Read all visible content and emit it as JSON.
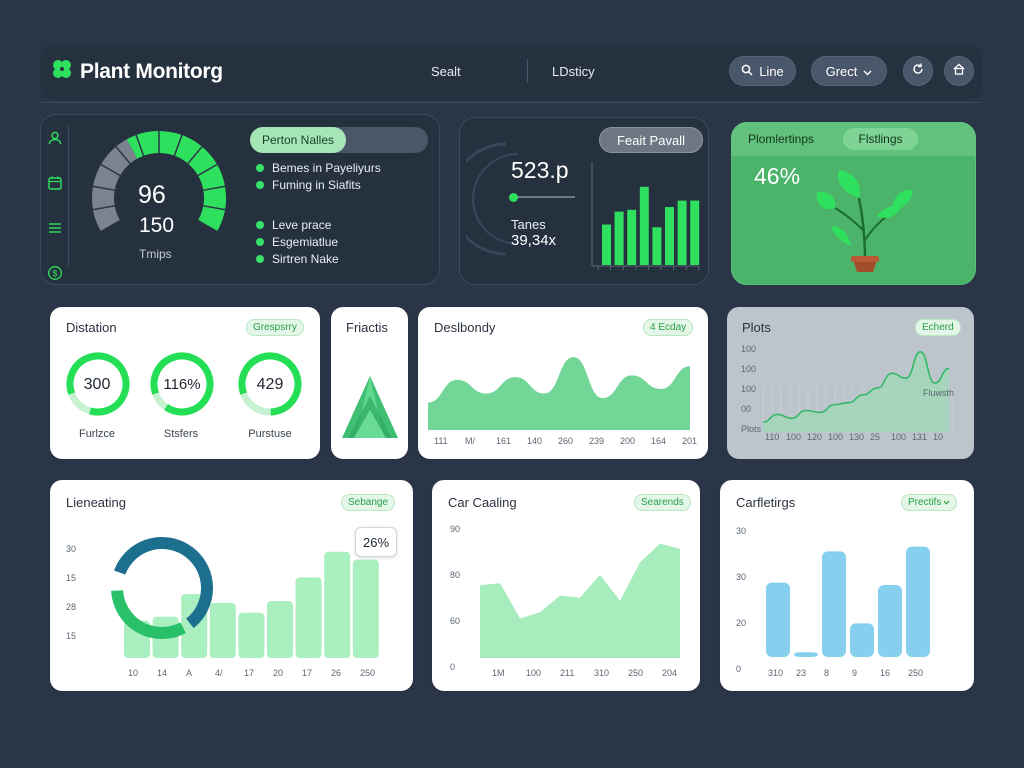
{
  "app": {
    "title": "Plant Monitorg"
  },
  "nav": {
    "link1": "Sealt",
    "link2": "LDsticy"
  },
  "controls": {
    "search_label": "Line",
    "select_label": "Grect"
  },
  "icons": {
    "brand": "clover-icon",
    "btn1": "refresh-icon",
    "btn2": "home-icon",
    "side": [
      "user-icon",
      "calendar-icon",
      "list-icon",
      "dollar-icon"
    ]
  },
  "colors": {
    "accent": "#2ee05e",
    "panel": "#26313f",
    "bg": "#2a3547",
    "mint": "#9ee9b0",
    "blue": "#86d0ef"
  },
  "gauge": {
    "value": "96",
    "sub": "150",
    "caption": "Tmips",
    "fill_fraction": 0.62
  },
  "legend_panel": {
    "header": "Perton Nalles",
    "items": [
      "Bemes in Payeliyurs",
      "Fuming in Siafits",
      "Leve prace",
      "Esgemiatlue",
      "Sirtren Nake"
    ]
  },
  "stat_panel": {
    "value": "523.p",
    "label": "Tanes",
    "value2": "39,34x",
    "badge": "Feait Pavall",
    "bar_values": [
      0.44,
      0.58,
      0.6,
      0.85,
      0.41,
      0.63,
      0.7,
      0.7
    ]
  },
  "plant_panel": {
    "title": "Plomlertinps",
    "tab": "Flstlings",
    "percent": "46%"
  },
  "distribution": {
    "title": "Distation",
    "tag": "Grespsrry",
    "rings": [
      {
        "value": "300",
        "label": "Furlzce",
        "fraction": 0.85
      },
      {
        "value": "116%",
        "label": "Stsfers",
        "fraction": 0.9
      },
      {
        "value": "429",
        "label": "Purstuse",
        "fraction": 0.8
      }
    ]
  },
  "fractis": {
    "title": "Friactis"
  },
  "deslbondy": {
    "title": "Deslbondy",
    "tag": "4 Ecday",
    "x_labels": [
      "111",
      "M/",
      "161",
      "140",
      "260",
      "239",
      "200",
      "164",
      "201"
    ]
  },
  "plots": {
    "title": "Plots",
    "tag": "Echerd",
    "annotation": "Fluwsth",
    "y_labels": [
      "100",
      "100",
      "100",
      "00",
      "Plots"
    ],
    "x_labels": [
      "110",
      "100",
      "120",
      "100",
      "130",
      "25",
      "100",
      "131",
      "10"
    ]
  },
  "lienearing": {
    "title": "Lieneating",
    "tag": "Sebange",
    "callout": "26%",
    "y_labels": [
      "30",
      "15",
      "28",
      "15"
    ],
    "x_labels": [
      "10",
      "14",
      "A",
      "4/",
      "17",
      "20",
      "17",
      "26",
      "250"
    ]
  },
  "car_caaling": {
    "title": "Car Caaling",
    "tag": "Searends",
    "y_labels": [
      "90",
      "80",
      "60",
      "0"
    ],
    "x_labels": [
      "1M",
      "100",
      "211",
      "310",
      "250",
      "204"
    ]
  },
  "carfletirgs": {
    "title": "Carfletirgs",
    "tag": "Prectifs",
    "y_labels": [
      "30",
      "30",
      "20",
      "0"
    ],
    "x_labels": [
      "310",
      "23",
      "8",
      "9",
      "16",
      "250"
    ]
  },
  "chart_data": [
    {
      "type": "area",
      "title": "Deslbondy",
      "x": [
        "111",
        "M/",
        "161",
        "140",
        "260",
        "239",
        "200",
        "164",
        "201"
      ],
      "values": [
        30,
        55,
        40,
        58,
        40,
        80,
        35,
        60,
        45,
        70
      ]
    },
    {
      "type": "area",
      "title": "Plots",
      "x": [
        "110",
        "100",
        "120",
        "100",
        "130",
        "25",
        "100",
        "131",
        "10"
      ],
      "values": [
        10,
        18,
        14,
        22,
        20,
        28,
        30,
        38,
        45,
        60,
        55,
        82,
        50,
        65
      ]
    },
    {
      "type": "bar",
      "title": "Lieneating",
      "x": [
        "10",
        "14",
        "A",
        "4/",
        "17",
        "20",
        "17",
        "26",
        "250"
      ],
      "values": [
        38,
        42,
        65,
        56,
        46,
        58,
        82,
        108,
        100
      ]
    },
    {
      "type": "area",
      "title": "Car Caaling",
      "x": [
        "1M",
        "100",
        "211",
        "310",
        "250",
        "204"
      ],
      "values": [
        70,
        72,
        38,
        44,
        60,
        58,
        80,
        55,
        92,
        110,
        105
      ]
    },
    {
      "type": "bar",
      "title": "Carfletirgs",
      "x": [
        "310",
        "23",
        "8",
        "9",
        "16",
        "250"
      ],
      "values": [
        62,
        4,
        88,
        28,
        60,
        92
      ]
    }
  ]
}
